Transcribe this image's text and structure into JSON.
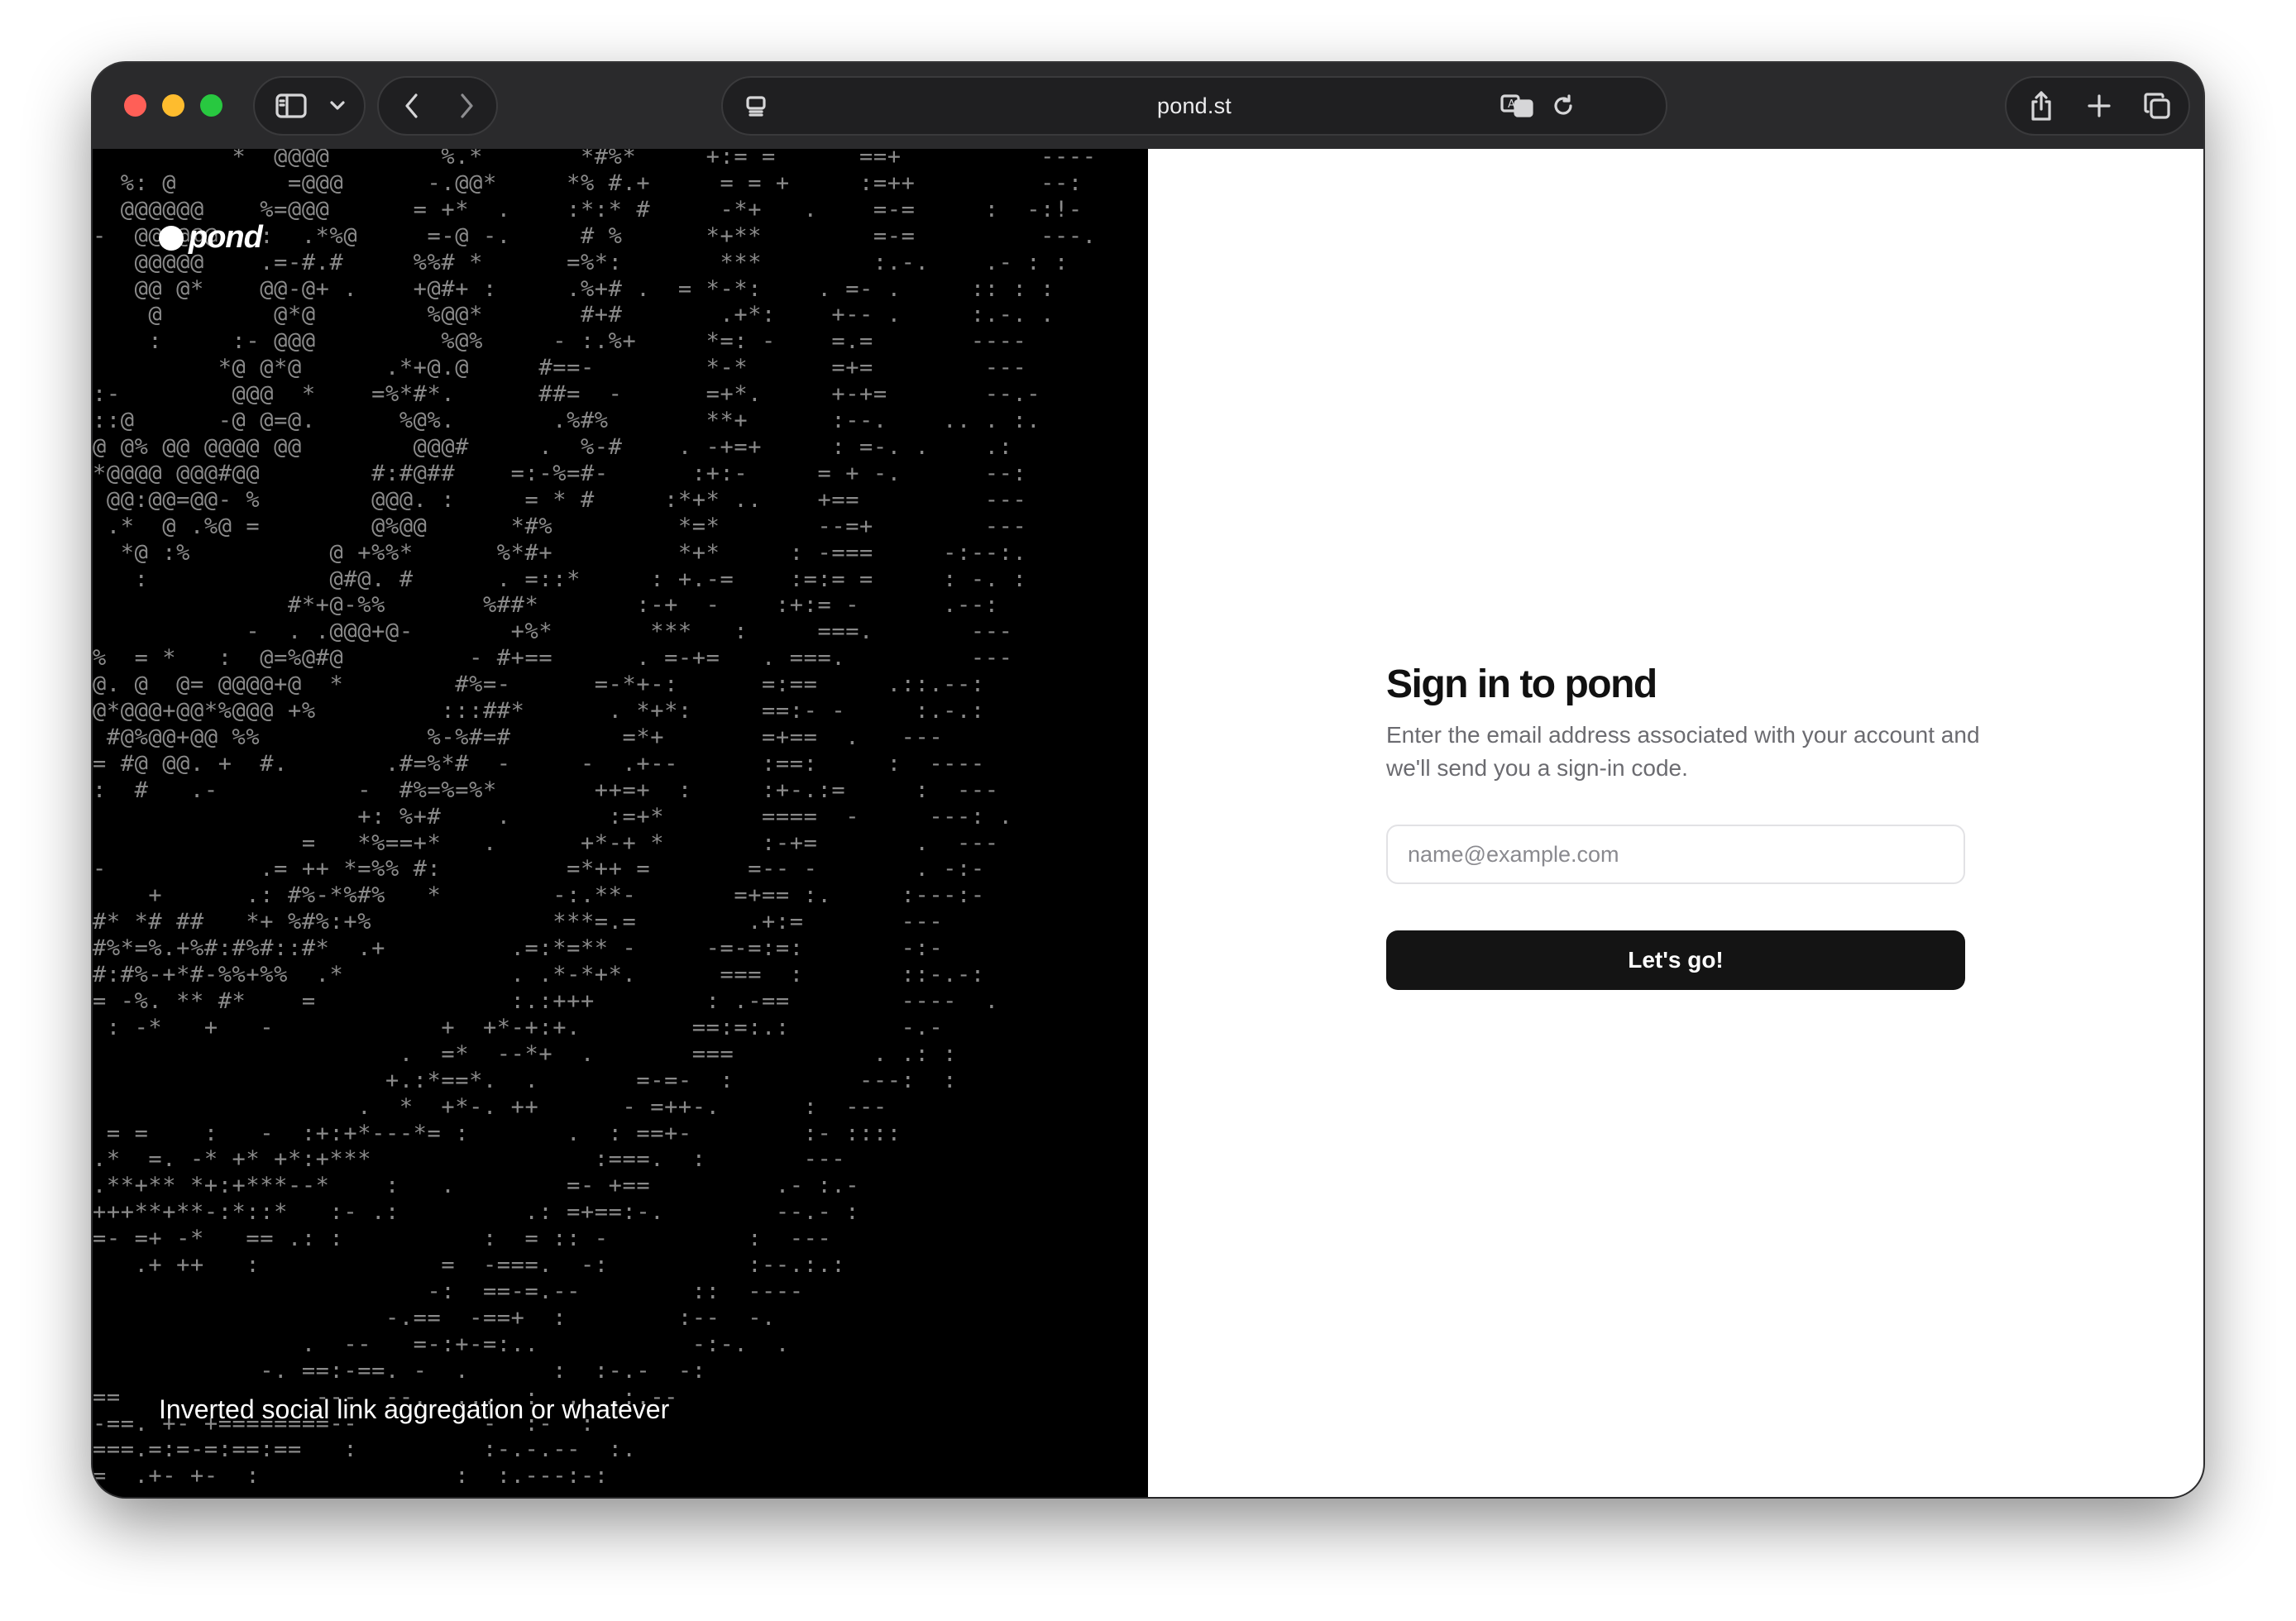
{
  "browser": {
    "url": "pond.st",
    "icons": [
      "sidebar-icon",
      "chevron-down-icon",
      "back-icon",
      "forward-icon",
      "page-menu-icon",
      "translate-icon",
      "reload-icon",
      "share-icon",
      "new-tab-icon",
      "tab-overview-icon"
    ]
  },
  "hero": {
    "logo_text": "pond",
    "tagline": "Inverted social link aggregation or whatever",
    "ascii_rows": [
      "          *  @@@@        %.*       *#%*     +:= =      ==+          ----",
      "  %: @        =@@@      -.@@*     *% #.+     = = +     :=++         --:",
      "  @@@@@@    %=@@@      = +*  .    :*:* #     -*+   .    =-=     :  -:!-",
      "-  @@@@@@   :  .*%@     =-@ -.     # %      *+**        =-=         ---.",
      "   @@@@@    .=-#.#     %%# *      =%*:       ***        :.-.    .- : :",
      "   @@ @*    @@-@+ .    +@#+ :     .%+# .  = *-*:    . =- .     :: : :",
      "    @        @*@        %@@*       #+#       .+*:    +-- .     :.-. .",
      "    :     :- @@@         %@%     - :.%+     *=: -    =.=       ----",
      "         *@ @*@      .*+@.@     #==-        *-*      =+=        ---",
      ":-        @@@  *    =%*#*.      ##=  -      =+*.     +-+=       --.-",
      "::@      -@ @=@.      %@%.       .%#%       **+      :--.    .. . :.",
      "@ @% @@ @@@@ @@        @@@#     .  %-#    . -+=+     : =-. .    .:",
      "*@@@@ @@@#@@        #:#@##    =:-%=#-      :+:-     = + -.      --:",
      " @@:@@=@@- %        @@@. :     = * #     :*+* ..    +==         ---",
      " .*  @ .%@ =        @%@@      *#%         *=*       --=+        ---",
      "  *@ :%          @ +%%*      %*#+         *+*     : -===     -:--:.",
      "   :             @#@. #      . =::*     : +.-=    :=:= =     : -. :",
      "              #*+@-%%       %##*       :-+  -    :+:= -      .--:",
      "           -  . .@@@+@-       +%*       ***   :     ===.       ---",
      "%  = *   :  @=%@#@         - #+==      . =-+=   . ===.         ---",
      "@. @  @= @@@@+@  *        #%=-      =-*+-:      =:==     .::.--:",
      "@*@@@+@@*%@@@ +%         :::##*      . *+*:     ==:- -     :.-.:",
      " #@%@@+@@ %%            %-%#=#        =*+       =+==  .   ---",
      "= #@ @@. +  #.       .#=%*#  -     -  .+--      :==:     :  ----",
      ":  #   .-          -  #%=%=%*       ++=+  :     :+-.:=     :  ---",
      "                   +: %+#    .       :=+*       ====  -     ---: .",
      "               =   *%==+*   .      +*-+ *       :-+=       .  ---",
      "-           .= ++ *=%% #:         =*++ =       =-- -       . -:-",
      "    +      .: #%-*%#%   *        -:.**-       =+== :.     :---:-",
      "#* *# ##   *+ %#%:+%             ***=.=        .+:=       ---",
      "#%*=%.+%#:#%#::#*  .+         .=:*=** -     -=-=:=:       -:-",
      "#:#%-+*#-%%+%%  .*            . .*-*+*.      ===  :       ::-.-:",
      "= -%. ** #*    =              :.:+++        : .-==        ----  .",
      " : -*   +   -            +  +*-+:+.        ==:=:.:        -.-",
      "                      .  =*  --*+  .       ===          . .: :",
      "                     +.:*==*.  .       =-=-  :         ---:  :",
      "                   .  *  +*-. ++      - =++-.      :  ---",
      " = =    :   -  :+:+*---*= :       .  : ==+-        :- ::::",
      ".*  =. -* +* +*:+***                :===.  :       ---",
      ".**+** *+:+***--*    :   .        =- +==         .- :.-",
      "+++**+**-:*::*   :- .:         .: =+==:-.        --.- :",
      "=- =+ -*   == .: :          :  = :: -          :  ---",
      "   .+ ++   :             =  -===.  -:          :--.:.:",
      "                        -:  ==-=.--        ::  ----",
      "                     -.==  -==+  :        :--  -.",
      "               .  --   =-:+-=:..           -:-.  .",
      "            -. ==:-==. -  .      :  :-.-  -:",
      "==              ---  --.  ...  :  ,  .:.--",
      "-==. +- +========--         -  :-  :",
      "===.=:=-=:==:==   :         :-.-.--  :.",
      "=  .+- +-  :              :  :.---:-:"
    ]
  },
  "signin": {
    "heading": "Sign in to pond",
    "description": "Enter the email address associated with your account and we'll send you a sign-in code.",
    "email_placeholder": "name@example.com",
    "email_value": "",
    "submit_label": "Let's go!"
  }
}
